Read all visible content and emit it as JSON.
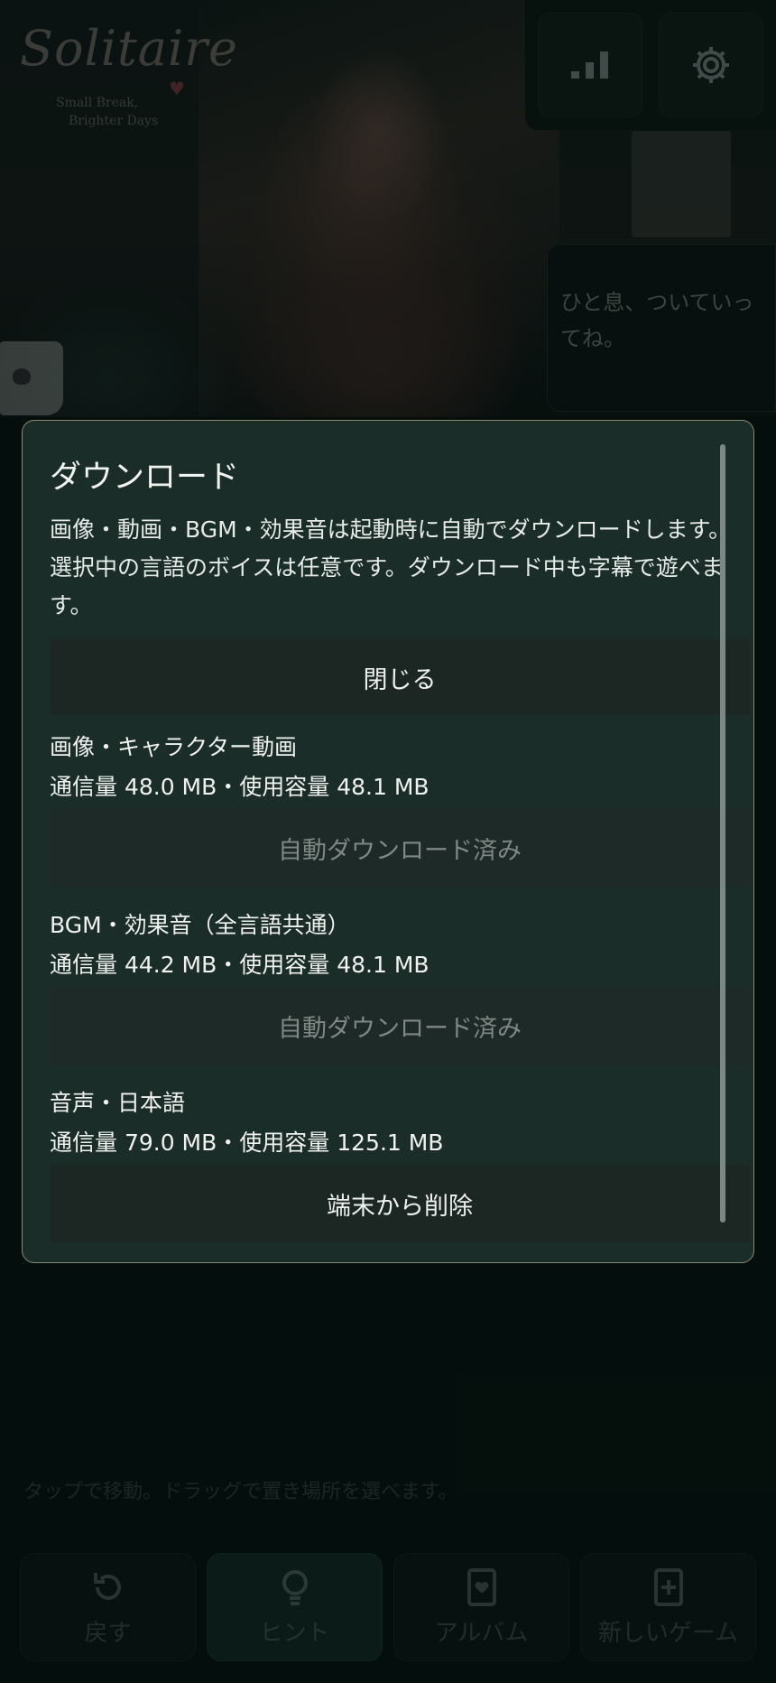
{
  "background": {
    "logo": {
      "title": "Solitaire",
      "tagline_line1": "Small Break,",
      "tagline_line2": "Brighter Days"
    },
    "top_buttons": [
      {
        "icon": "stats-icon"
      },
      {
        "icon": "gear-icon"
      }
    ],
    "speech_bubble": "ひと息、ついていってね。",
    "tap_hint": "タップで移動。ドラッグで置き場所を選べます。",
    "bottom_bar": [
      {
        "icon": "undo-icon",
        "label": "戻す"
      },
      {
        "icon": "lightbulb-icon",
        "label": "ヒント"
      },
      {
        "icon": "album-card-icon",
        "label": "アルバム"
      },
      {
        "icon": "new-card-icon",
        "label": "新しいゲーム"
      }
    ]
  },
  "modal": {
    "title": "ダウンロード",
    "description": "画像・動画・BGM・効果音は起動時に自動でダウンロードします。選択中の言語のボイスは任意です。ダウンロード中も字幕で遊べます。",
    "close_label": "閉じる",
    "sections": [
      {
        "name": "画像・キャラクター動画",
        "meta": "通信量 48.0 MB・使用容量 48.1 MB",
        "action": "自動ダウンロード済み"
      },
      {
        "name": "BGM・効果音（全言語共通）",
        "meta": "通信量 44.2 MB・使用容量 48.1 MB",
        "action": "自動ダウンロード済み"
      },
      {
        "name": "音声・日本語",
        "meta": "通信量 79.0 MB・使用容量 125.1 MB",
        "action": "端末から削除"
      }
    ]
  },
  "colors": {
    "modal_bg": "#1b2d28",
    "modal_border": "#8a8a6e",
    "button_bg": "#1c2623",
    "disabled_text": "#7f8884"
  }
}
